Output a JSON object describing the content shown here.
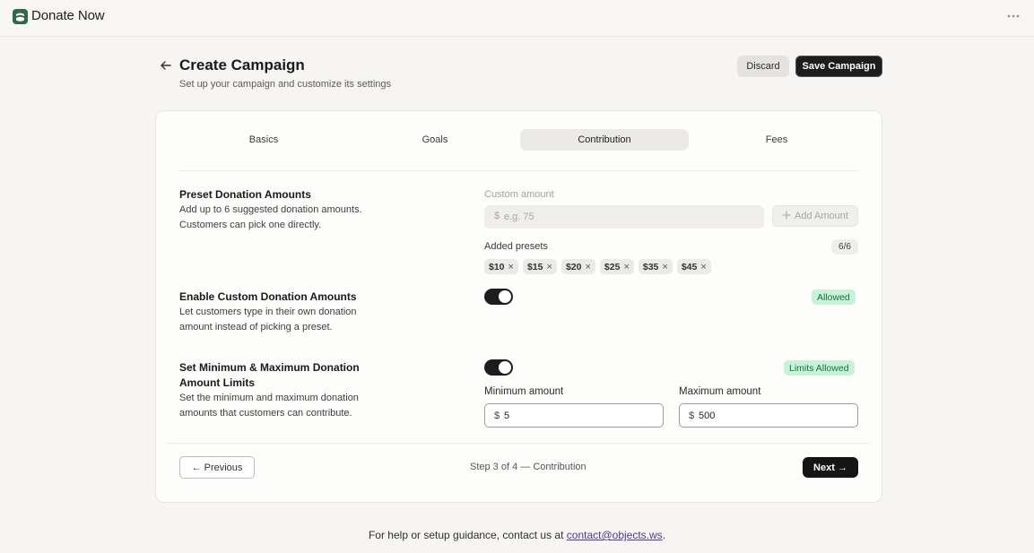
{
  "app": {
    "title": "Donate Now"
  },
  "header": {
    "title": "Create Campaign",
    "subtitle": "Set up your campaign and customize its settings",
    "discard_label": "Discard",
    "save_label": "Save Campaign"
  },
  "tabs": [
    {
      "label": "Basics",
      "active": false
    },
    {
      "label": "Goals",
      "active": false
    },
    {
      "label": "Contribution",
      "active": true
    },
    {
      "label": "Fees",
      "active": false
    }
  ],
  "preset": {
    "title": "Preset Donation Amounts",
    "description": "Add up to 6 suggested donation amounts. Customers can pick one directly.",
    "custom_label": "Custom amount",
    "currency": "$",
    "placeholder": "e.g. 75",
    "add_label": "Add Amount",
    "added_label": "Added presets",
    "count": "6/6",
    "chips": [
      "$10",
      "$15",
      "$20",
      "$25",
      "$35",
      "$45"
    ]
  },
  "custom": {
    "title": "Enable Custom Donation Amounts",
    "description": "Let customers type in their own donation amount instead of picking a preset.",
    "enabled": true,
    "status": "Allowed"
  },
  "limits": {
    "title": "Set Minimum & Maximum Donation Amount Limits",
    "description": "Set the minimum and maximum donation amounts that customers can contribute.",
    "enabled": true,
    "status": "Limits Allowed",
    "min_label": "Minimum amount",
    "min_value": "5",
    "max_label": "Maximum amount",
    "max_value": "500",
    "currency": "$"
  },
  "footer": {
    "previous_label": "← Previous",
    "step_text": "Step 3 of 4 — Contribution",
    "next_label": "Next →"
  },
  "help": {
    "text": "For help or setup guidance, contact us at",
    "email": "contact@objects.ws",
    "suffix": "."
  },
  "colors": {
    "brand": "#2f6a45",
    "accent": "#1d1d1d",
    "status_bg": "#c7f2d9",
    "status_fg": "#1f6b3f"
  }
}
